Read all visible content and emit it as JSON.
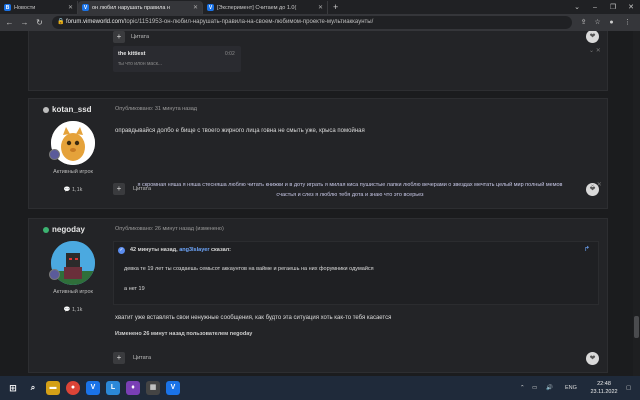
{
  "browser": {
    "tabs": [
      {
        "label": "Новости",
        "favicon": "vk",
        "active": false
      },
      {
        "label": "он любил нарушать правила н",
        "favicon": "vimeworld",
        "active": true
      },
      {
        "label": "[Эксперимент] Считаем до 1.0(",
        "favicon": "vimeworld",
        "active": false
      }
    ],
    "url_host": "forum.vimeworld.com",
    "url_path": "/topic/1151953-он-любил-нарушать-правила-на-своем-любимом-проекте-мультиаккаунты/"
  },
  "top_fragment": {
    "quote_label": "Цитата",
    "audio_title": "the kittiest",
    "audio_subtitle": "ты что илон маск...",
    "audio_time": "0:02"
  },
  "posts": [
    {
      "username": "kotan_ssd",
      "status_color": "#bdbdbd",
      "posted": "Опубликовано: 31 минута назад",
      "body": "оправдывайся долбо е бище с твоего жирного лица говна не смыть уже, крыса помойная",
      "rank": "Активный игрок",
      "reputation": "1,1k",
      "quote_label": "Цитата",
      "signature_line1": "я скромная няша я няша стесняша люблю читать книжки и в доту играть я милая киса пушистые лапки люблю вечерами о звездах мечтать целый мир полный мемов",
      "signature_line2": "счастья и слез я люблю тебя дота и знаю что это всерьез"
    },
    {
      "username": "negoday",
      "status_color": "#3cb371",
      "posted": "Опубликовано: 26 минут назад (изменено)",
      "rank": "Активный игрок",
      "reputation": "1,1k",
      "quote_header_prefix": "42 минуты назад,",
      "quote_author": "ang3lslayer",
      "quote_header_suffix": "сказал:",
      "quote_line1": "девка те 19 лет ты создаешь семьсот аккаунтов на вайме и регаешь на них форумники одумайся",
      "quote_line2": "а нет 19",
      "body": "хватит уже вставлять свои ненужные сообщения, как будто эта ситуация хоть как-то тебя касается",
      "edited_note": "Изменено 26 минут назад пользователем negoday",
      "quote_label": "Цитата"
    }
  ],
  "taskbar": {
    "lang": "ENG",
    "time": "22:48",
    "date": "23.11.2022"
  }
}
